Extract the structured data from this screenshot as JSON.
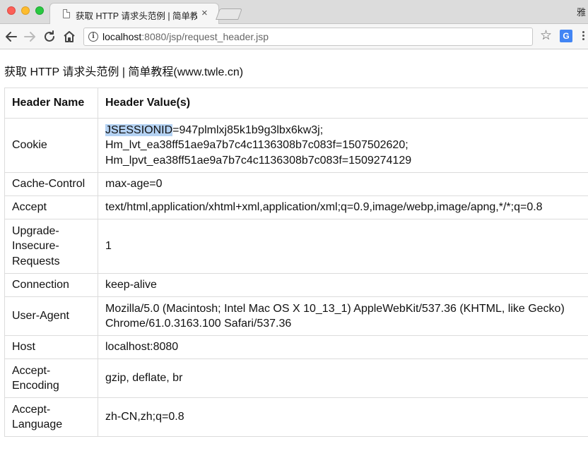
{
  "browser": {
    "tab_title": "获取 HTTP 请求头范例 | 简单教",
    "tab_close": "×",
    "corner_text": "雅",
    "url_host": "localhost",
    "url_rest": ":8080/jsp/request_header.jsp",
    "info_glyph": "i",
    "star_glyph": "☆",
    "translate_glyph": "G"
  },
  "page": {
    "heading": "获取 HTTP 请求头范例 | 简单教程(www.twle.cn)"
  },
  "table": {
    "headers": [
      "Header Name",
      "Header Value(s)"
    ],
    "rows": [
      {
        "name": "Cookie",
        "value_selected": "JSESSIONID",
        "value_lines": [
          "=947plmlxj85k1b9g3lbx6kw3j;",
          "Hm_lvt_ea38ff51ae9a7b7c4c1136308b7c083f=1507502620;",
          "Hm_lpvt_ea38ff51ae9a7b7c4c1136308b7c083f=1509274129"
        ]
      },
      {
        "name": "Cache-Control",
        "value": "max-age=0"
      },
      {
        "name": "Accept",
        "value": "text/html,application/xhtml+xml,application/xml;q=0.9,image/webp,image/apng,*/*;q=0.8"
      },
      {
        "name_lines": [
          "Upgrade-",
          "Insecure-",
          "Requests"
        ],
        "value": "1"
      },
      {
        "name": "Connection",
        "value": "keep-alive"
      },
      {
        "name": "User-Agent",
        "value_lines": [
          "Mozilla/5.0 (Macintosh; Intel Mac OS X 10_13_1) AppleWebKit/537.36 (KHTML, like Gecko)",
          "Chrome/61.0.3163.100 Safari/537.36"
        ]
      },
      {
        "name": "Host",
        "value": "localhost:8080"
      },
      {
        "name_lines": [
          "Accept-",
          "Encoding"
        ],
        "value": "gzip, deflate, br"
      },
      {
        "name_lines": [
          "Accept-",
          "Language"
        ],
        "value": "zh-CN,zh;q=0.8"
      }
    ]
  }
}
